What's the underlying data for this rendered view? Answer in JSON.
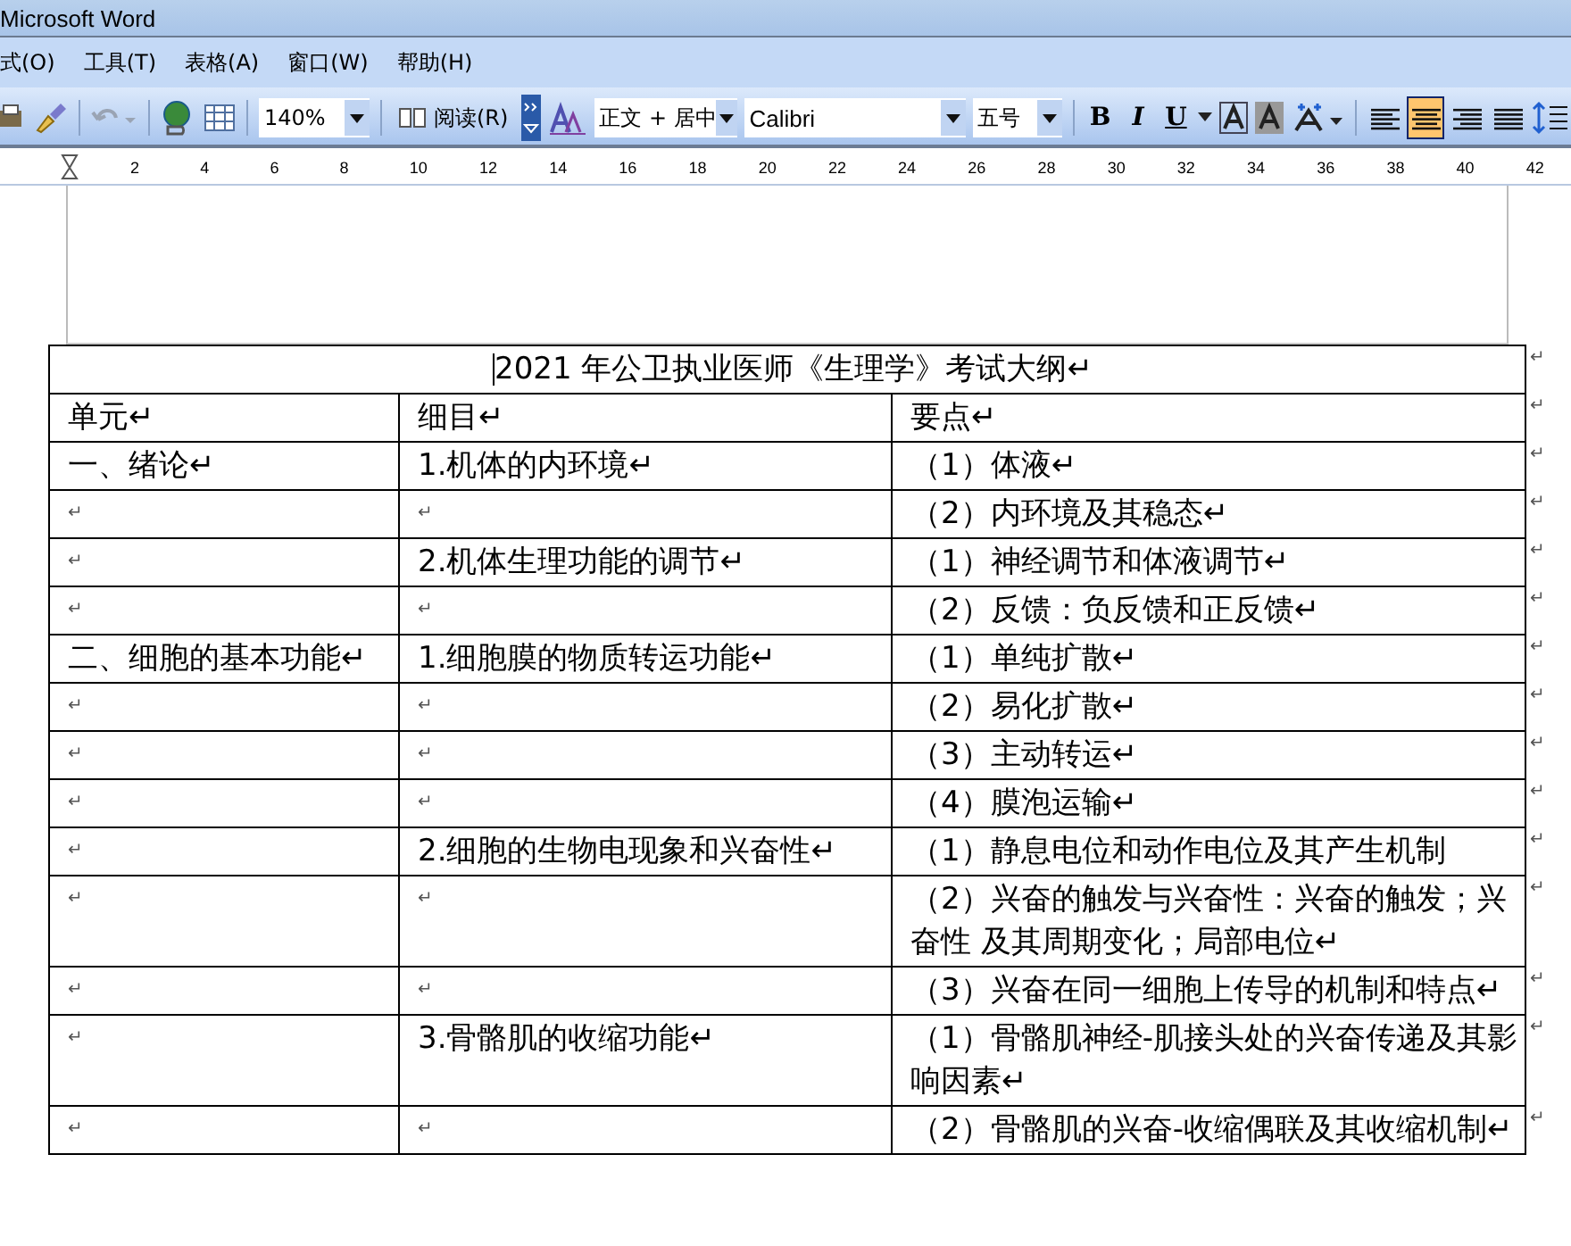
{
  "window": {
    "title": "Microsoft Word"
  },
  "menu": [
    "式(O)",
    "工具(T)",
    "表格(A)",
    "窗口(W)",
    "帮助(H)"
  ],
  "toolbar": {
    "zoom": "140%",
    "read_button": "阅读(R)",
    "style": "正文 + 居中",
    "font": "Calibri",
    "size": "五号",
    "format_buttons": [
      {
        "label": "B",
        "kind": "bold",
        "selected": false
      },
      {
        "label": "I",
        "kind": "italic",
        "selected": false
      },
      {
        "label": "U",
        "kind": "underline",
        "selected": false
      }
    ],
    "align_buttons": [
      {
        "kind": "left",
        "selected": false
      },
      {
        "kind": "center",
        "selected": true
      },
      {
        "kind": "right",
        "selected": false
      },
      {
        "kind": "distributed",
        "selected": false
      }
    ]
  },
  "ruler": {
    "ticks": [
      "2",
      "4",
      "6",
      "8",
      "10",
      "12",
      "14",
      "16",
      "18",
      "20",
      "22",
      "24",
      "26",
      "28",
      "30",
      "32",
      "34",
      "36",
      "38",
      "40",
      "42"
    ]
  },
  "table": {
    "title": "2021 年公卫执业医师《生理学》考试大纲↵",
    "end_mark": "↵",
    "columns": [
      "单元↵",
      "细目↵",
      "要点↵"
    ],
    "rows": [
      [
        "一、绪论↵",
        "1.机体的内环境↵",
        "（1）体液↵"
      ],
      [
        "↵",
        "↵",
        "（2）内环境及其稳态↵"
      ],
      [
        "↵",
        "2.机体生理功能的调节↵",
        "（1）神经调节和体液调节↵"
      ],
      [
        "↵",
        "↵",
        "（2）反馈：负反馈和正反馈↵"
      ],
      [
        "二、细胞的基本功能↵",
        "1.细胞膜的物质转运功能↵",
        "（1）单纯扩散↵"
      ],
      [
        "↵",
        "↵",
        "（2）易化扩散↵"
      ],
      [
        "↵",
        "↵",
        "（3）主动转运↵"
      ],
      [
        "↵",
        "↵",
        "（4）膜泡运输↵"
      ],
      [
        "↵",
        "2.细胞的生物电现象和兴奋性↵",
        "（1）静息电位和动作电位及其产生机制"
      ],
      [
        "↵",
        "↵",
        "（2）兴奋的触发与兴奋性：兴奋的触发；兴奋性 及其周期变化；局部电位↵"
      ],
      [
        "↵",
        "↵",
        "（3）兴奋在同一细胞上传导的机制和特点↵"
      ],
      [
        "↵",
        "3.骨骼肌的收缩功能↵",
        "（1）骨骼肌神经-肌接头处的兴奋传递及其影响因素↵"
      ],
      [
        "↵",
        "↵",
        "（2）骨骼肌的兴奋-收缩偶联及其收缩机制↵"
      ]
    ]
  }
}
